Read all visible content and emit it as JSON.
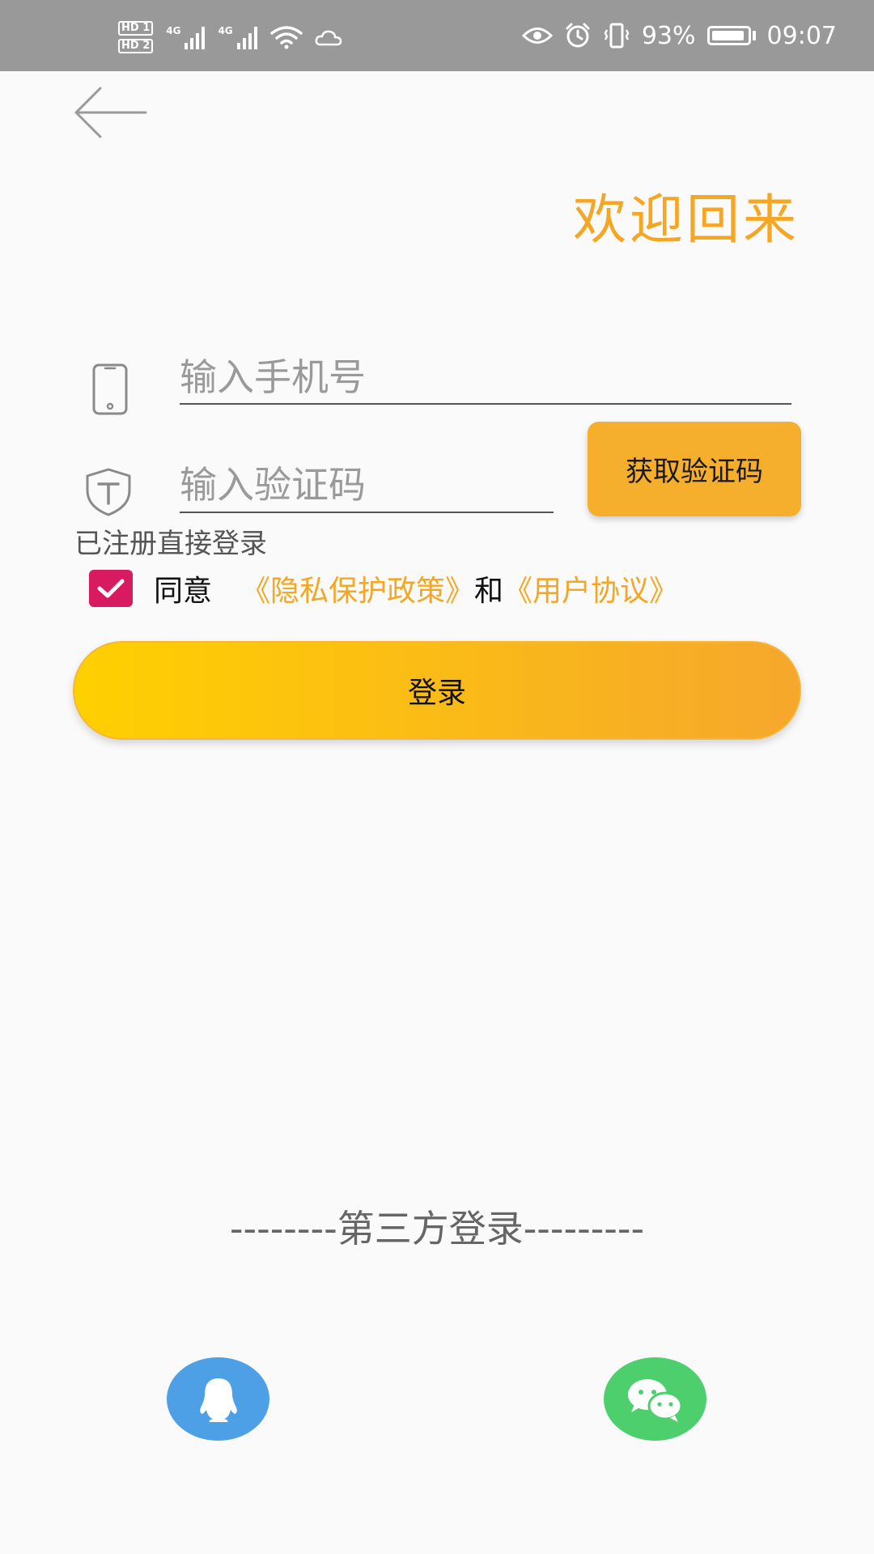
{
  "status_bar": {
    "sim1_label": "HD 1",
    "sim2_label": "HD 2",
    "network1": "4G",
    "network2": "4G",
    "battery_percent": "93%",
    "battery_level": 0.93,
    "time": "09:07",
    "icons": [
      "signal-icon",
      "wifi-icon",
      "cloud-icon",
      "eye-icon",
      "alarm-icon",
      "vibrate-icon",
      "battery-icon"
    ]
  },
  "header": {
    "back_icon": "arrow-left-icon",
    "title": "欢迎回来"
  },
  "form": {
    "phone_placeholder": "输入手机号",
    "code_placeholder": "输入验证码",
    "get_code_label": "获取验证码",
    "direct_login_text": "已注册直接登录"
  },
  "agreement": {
    "checked": true,
    "agree_text": "同意",
    "privacy_link": "《隐私保护政策》",
    "and_text": "和",
    "user_link": "《用户协议》"
  },
  "login": {
    "button_label": "登录"
  },
  "third_party": {
    "label": "--------第三方登录---------",
    "qq_icon": "qq-penguin-icon",
    "wechat_icon": "wechat-icon"
  },
  "colors": {
    "accent": "#f5a623",
    "checkbox": "#d81b60",
    "qq": "#4ea0e6",
    "wechat": "#4ccf6c",
    "status_bar": "#999999"
  }
}
